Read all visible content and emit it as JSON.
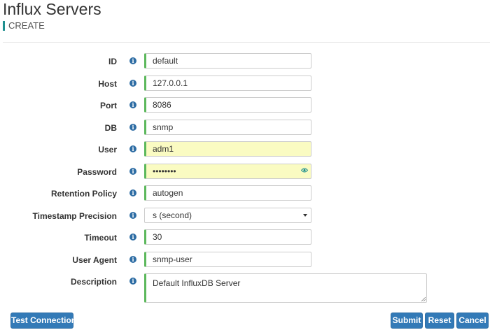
{
  "header": {
    "title": "Influx Servers",
    "subtitle": "CREATE"
  },
  "form": {
    "id": {
      "label": "ID",
      "value": "default"
    },
    "host": {
      "label": "Host",
      "value": "127.0.0.1"
    },
    "port": {
      "label": "Port",
      "value": "8086"
    },
    "db": {
      "label": "DB",
      "value": "snmp"
    },
    "user": {
      "label": "User",
      "value": "adm1"
    },
    "password": {
      "label": "Password",
      "value": "••••••••"
    },
    "retention_policy": {
      "label": "Retention Policy",
      "value": "autogen"
    },
    "timestamp_precision": {
      "label": "Timestamp Precision",
      "value": "s (second)"
    },
    "timeout": {
      "label": "Timeout",
      "value": "30"
    },
    "user_agent": {
      "label": "User Agent",
      "value": "snmp-user"
    },
    "description": {
      "label": "Description",
      "value": "Default InfluxDB Server"
    }
  },
  "buttons": {
    "test_connection": "Test Connection",
    "submit": "Submit",
    "reset": "Reset",
    "cancel": "Cancel"
  },
  "icons": {
    "info": "info-icon",
    "eye": "eye-icon",
    "dropdown": "chevron-down-icon"
  },
  "colors": {
    "primary": "#337ab7",
    "accent_teal": "#1f8f8f",
    "valid_green": "#5cb85c",
    "autofill_yellow": "#fafbc2"
  }
}
